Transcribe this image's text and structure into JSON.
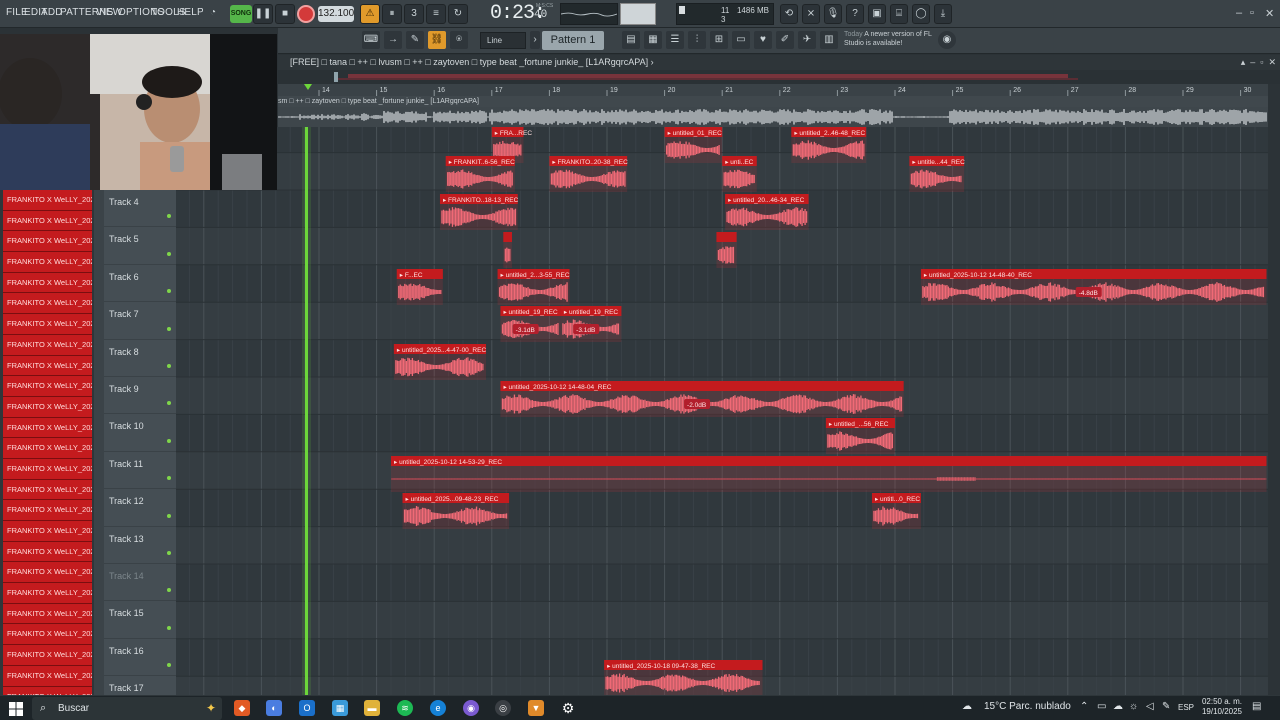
{
  "menu": [
    "FILE",
    "EDIT",
    "ADD",
    "PATTERNS",
    "VIEW",
    "OPTIONS",
    "TOOLS",
    "HELP"
  ],
  "transport": {
    "mode_label": "SONG",
    "tempo": "132.100",
    "time": "0:23:",
    "time_seconds": "40",
    "time_label": "M:S:CS",
    "cpu_value_1": "11",
    "cpu_value_2": "3",
    "memory": "1486 MB"
  },
  "toolbar2": {
    "snap_label": "Line",
    "pattern_label": "Pattern 1",
    "news_today": "Today",
    "news_text": "A newer version of FL Studio is available!"
  },
  "playlist": {
    "title": "[FREE] □ tana □ ++ □ lvusm □ ++ □ zaytoven □ type beat _fortune junkie_ [L1ARgqrcAPA] ›",
    "audio_track_name": "sm □ ++ □ zaytoven □ type beat _fortune junkie_ [L1ARgqrcAPA]",
    "bars": [
      "14",
      "15",
      "16",
      "17",
      "18",
      "19",
      "20",
      "21",
      "22",
      "23",
      "24",
      "25",
      "26",
      "27",
      "28",
      "29",
      "30"
    ]
  },
  "clip_list": [
    "FRANKITO X WeLLY_2025-",
    "FRANKITO X WeLLY_2025-",
    "FRANKITO X WeLLY_2025-",
    "FRANKITO X WeLLY_2025-",
    "FRANKITO X WeLLY_2025-",
    "FRANKITO X WeLLY_2025-",
    "FRANKITO X WeLLY_2025-",
    "FRANKITO X WeLLY_2025-",
    "FRANKITO X WeLLY_2025-",
    "FRANKITO X WeLLY_2025-",
    "FRANKITO X WeLLY_2025-",
    "FRANKITO X WeLLY_2025-",
    "FRANKITO X WeLLY_2025-",
    "FRANKITO X WeLLY_2025-",
    "FRANKITO X WeLLY_2025-",
    "FRANKITO X WeLLY_2025-",
    "FRANKITO X WeLLY_2025-",
    "FRANKITO X WeLLY_2025-",
    "FRANKITO X WeLLY_2025-",
    "FRANKITO X WeLLY_2025-",
    "FRANKITO X WeLLY_2025-",
    "FRANKITO X WeLLY_2025-",
    "FRANKITO X WeLLY_2025-",
    "FRANKITO X WeLLY_2025-",
    "FRANKITO X WeLLY_2025-"
  ],
  "tracks": [
    {
      "label": "Track 4",
      "muted": false
    },
    {
      "label": "Track 5",
      "muted": false
    },
    {
      "label": "Track 6",
      "muted": false
    },
    {
      "label": "Track 7",
      "muted": false
    },
    {
      "label": "Track 8",
      "muted": false
    },
    {
      "label": "Track 9",
      "muted": false
    },
    {
      "label": "Track 10",
      "muted": false
    },
    {
      "label": "Track 11",
      "muted": false
    },
    {
      "label": "Track 12",
      "muted": false
    },
    {
      "label": "Track 13",
      "muted": false
    },
    {
      "label": "Track 14",
      "muted": true
    },
    {
      "label": "Track 15",
      "muted": false
    },
    {
      "label": "Track 16",
      "muted": false
    },
    {
      "label": "Track 17",
      "muted": false
    }
  ],
  "clips": [
    {
      "lane": 0,
      "start": 17.0,
      "end": 17.55,
      "label": "FRA...REC",
      "gain": ""
    },
    {
      "lane": 0,
      "start": 20.0,
      "end": 21.0,
      "label": "untitled_01_REC",
      "gain": ""
    },
    {
      "lane": 0,
      "start": 22.2,
      "end": 23.5,
      "label": "untitled_2..46-48_REC",
      "gain": ""
    },
    {
      "lane": 1,
      "start": 16.2,
      "end": 17.4,
      "label": "FRANKIT..6-56_REC",
      "gain": ""
    },
    {
      "lane": 1,
      "start": 18.0,
      "end": 19.35,
      "label": "FRANKITO..20-38_REC",
      "gain": ""
    },
    {
      "lane": 1,
      "start": 21.0,
      "end": 21.6,
      "label": "unti..EC",
      "gain": ""
    },
    {
      "lane": 1,
      "start": 24.25,
      "end": 25.2,
      "label": "untitle...44_REC",
      "gain": ""
    },
    {
      "lane": 2,
      "start": 16.1,
      "end": 17.45,
      "label": "FRANKITO..18-13_REC",
      "gain": ""
    },
    {
      "lane": 2,
      "start": 21.05,
      "end": 22.5,
      "label": "untitled_20...46-34_REC",
      "gain": ""
    },
    {
      "lane": 3,
      "start": 17.2,
      "end": 17.35,
      "label": "",
      "gain": ""
    },
    {
      "lane": 3,
      "start": 20.9,
      "end": 21.25,
      "label": "",
      "gain": ""
    },
    {
      "lane": 4,
      "start": 15.35,
      "end": 16.15,
      "label": "F...EC",
      "gain": ""
    },
    {
      "lane": 4,
      "start": 17.1,
      "end": 18.35,
      "label": "untitled_2...3-55_REC",
      "gain": ""
    },
    {
      "lane": 4,
      "start": 24.45,
      "end": 30.45,
      "label": "untitled_2025-10-12 14-48-40_REC",
      "gain": "-4.8dB"
    },
    {
      "lane": 5,
      "start": 17.15,
      "end": 18.2,
      "label": "untitled_19_REC",
      "gain": "-3.1dB"
    },
    {
      "lane": 5,
      "start": 18.2,
      "end": 19.25,
      "label": "untitled_19_REC",
      "gain": "-3.1dB"
    },
    {
      "lane": 6,
      "start": 15.3,
      "end": 16.9,
      "label": "untitled_2025...4-47-00_REC",
      "gain": ""
    },
    {
      "lane": 7,
      "start": 17.15,
      "end": 24.15,
      "label": "untitled_2025-10-12 14-48-04_REC",
      "gain": "-2.0dB"
    },
    {
      "lane": 8,
      "start": 22.8,
      "end": 24.0,
      "label": "untitled_...56_REC",
      "gain": ""
    },
    {
      "lane": 9,
      "start": 15.25,
      "end": 30.45,
      "label": "untitled_2025-10-12 14-53-29_REC",
      "gain": ""
    },
    {
      "lane": 10,
      "start": 15.45,
      "end": 17.3,
      "label": "untitled_2025...09-48-23_REC",
      "gain": ""
    },
    {
      "lane": 10,
      "start": 23.6,
      "end": 24.45,
      "label": "untitl...0_REC",
      "gain": ""
    },
    {
      "lane": 14,
      "start": 18.95,
      "end": 21.7,
      "label": "untitled_2025-10-18 09-47-38_REC",
      "gain": ""
    }
  ],
  "taskbar": {
    "search_placeholder": "Buscar",
    "weather": "15°C  Parc. nublado",
    "language": "ESP",
    "time": "02:50 a. m.",
    "date": "19/10/2025"
  },
  "colors": {
    "clip_fill": "#c8303a",
    "clip_header": "#c41b1e",
    "wave": "#f06a76",
    "grid_bg": "#323a3f",
    "playhead": "#6dd63a"
  }
}
